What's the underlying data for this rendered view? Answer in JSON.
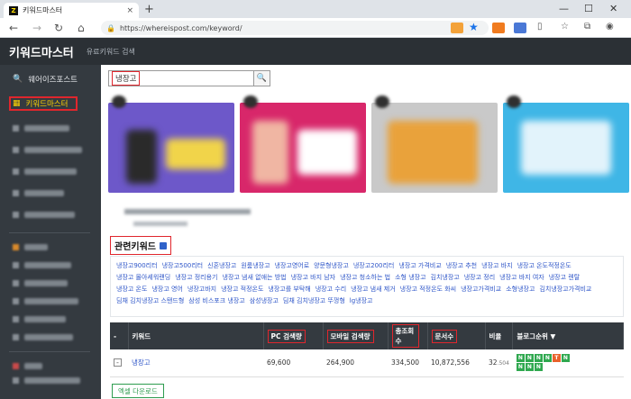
{
  "browser": {
    "tab_title": "키워드마스터",
    "tab_close": "×",
    "new_tab": "+",
    "url": "https://whereispost.com/keyword/",
    "favicon_letter": "Z"
  },
  "site": {
    "brand": "키워드마스터",
    "subtitle": "유료키워드 검색"
  },
  "sidebar": {
    "items": [
      {
        "label": "웨어이즈포스트",
        "icon": "search-icon"
      },
      {
        "label": "키워드마스터",
        "icon": "grid-icon",
        "active": true
      }
    ]
  },
  "search": {
    "value": "냉장고",
    "icon": "search-icon"
  },
  "related": {
    "title": "관련키워드",
    "keywords": [
      "냉장고900리터",
      "냉장고500리터",
      "신혼냉장고",
      "원룸냉장고",
      "냉장고영어로",
      "양문형냉장고",
      "냉장고200리터",
      "냉장고 가격비교",
      "냉장고 추천",
      "냉장고 바지",
      "냉장고 온도적정온도",
      "냉장고 몰아세워랜딩",
      "냉장고 정리용기",
      "냉장고 냄새 없애는 방법",
      "냉장고 바지 남자",
      "냉장고 청소하는 법",
      "소형 냉장고",
      "김치냉장고",
      "냉장고 정리",
      "냉장고 바지 여자",
      "냉장고 렌탈",
      "냉장고 온도",
      "냉장고 영어",
      "냉장고바지",
      "냉장고 적정온도",
      "냉장고를 부탁해",
      "냉장고 수리",
      "냉장고 냄새 제거",
      "냉장고 적정온도 화씨",
      "냉장고가격비교",
      "소형냉장고",
      "김치냉장고가격비교",
      "딤채 김치냉장고 스탠드형",
      "삼성 비스포크 냉장고",
      "삼성냉장고",
      "딤채 김치냉장고 뚜껑형",
      "lg냉장고"
    ]
  },
  "table": {
    "headers": {
      "dash": "-",
      "keyword": "키워드",
      "pc": "PC 검색량",
      "mobile": "모바일 검색량",
      "total": "총조회수",
      "docs": "문서수",
      "ratio": "비율",
      "blog_rank": "블로그순위 ▼"
    },
    "row": {
      "expand": "-",
      "keyword": "냉장고",
      "pc": "69,600",
      "mobile": "264,900",
      "total": "334,500",
      "docs": "10,872,556",
      "ratio_main": "32",
      "ratio_sub": ".504",
      "badges": [
        {
          "t": "N",
          "c": "#2fa84f"
        },
        {
          "t": "N",
          "c": "#2fa84f"
        },
        {
          "t": "N",
          "c": "#2fa84f"
        },
        {
          "t": "N",
          "c": "#2fa84f"
        },
        {
          "t": "T",
          "c": "#e8622c"
        },
        {
          "t": "N",
          "c": "#2fa84f"
        },
        {
          "t": "N",
          "c": "#2fa84f"
        },
        {
          "t": "N",
          "c": "#2fa84f"
        },
        {
          "t": "N",
          "c": "#2fa84f"
        }
      ]
    }
  },
  "excel_button": "엑셀 다운로드",
  "colors": {
    "accent_red": "#e0262d",
    "header_dark": "#2b3035",
    "sidebar_dark": "#343a40",
    "link_blue": "#2d55c8",
    "badge_green": "#2fa84f",
    "badge_orange": "#e8622c"
  }
}
